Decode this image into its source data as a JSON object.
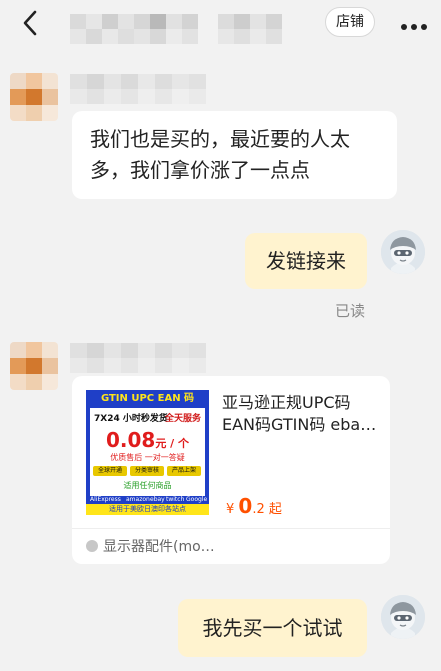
{
  "header": {
    "back_icon": "chevron-left-icon",
    "shop_button_label": "店铺",
    "more_icon": "more-dots-icon"
  },
  "messages": {
    "seller_message_1": {
      "lines": [
        "我们也是买的，最近要的人太",
        "多，我们拿价涨了一点点"
      ]
    },
    "buyer_message_1": {
      "text": "发链接来",
      "status": "已读"
    },
    "product_card": {
      "image": {
        "top_banner": "GTIN UPC EAN 码",
        "row_left": "7X24 小时秒发货",
        "row_right": "全天服务",
        "price_main": "0.08",
        "price_unit": "元 / 个",
        "subtitle": "优质售后 一对一答疑",
        "tag_1": "全球开通",
        "tag_2": "分类审核",
        "tag_3": "产品上架",
        "cta": "适用任何商品",
        "logos": [
          "AliExpress",
          "amazon",
          "ebay",
          "twitch",
          "Google"
        ],
        "bottom_banner": "适用于美欧日澳印各站点"
      },
      "title_lines": [
        "亚马逊正规UPC码",
        "EAN码GTIN码 eba…"
      ],
      "price_symbol": "¥",
      "price_integer": "0",
      "price_decimal": ".2",
      "price_suffix": "起",
      "footer_label": "显示器配件(mo…"
    },
    "buyer_message_2": {
      "text": "我先买一个试试"
    }
  },
  "colors": {
    "background": "#f2f2f2",
    "outgoing_bubble": "#fff3cf",
    "incoming_bubble": "#ffffff",
    "price": "#ff5000"
  }
}
